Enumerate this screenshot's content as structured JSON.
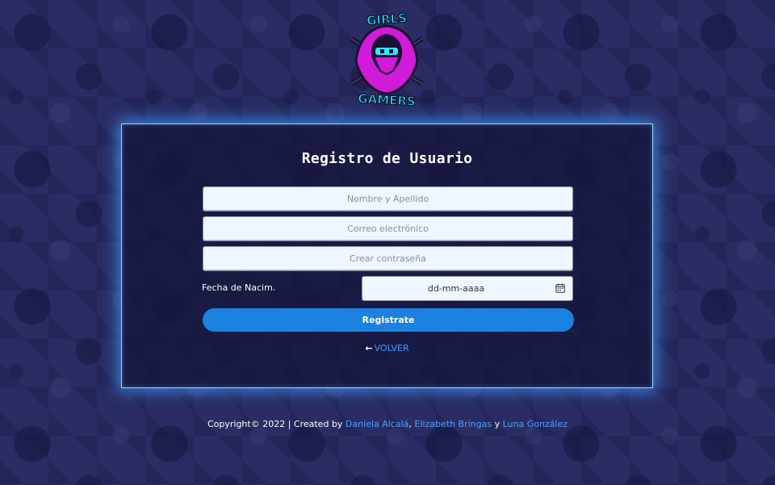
{
  "logo": {
    "top_text": "GIRLS",
    "bottom_text": "GAMERS",
    "colors": {
      "accent": "#2ee8ff",
      "hood": "#d21bd8",
      "dark": "#1a1033"
    }
  },
  "card": {
    "title": "Registro de Usuario",
    "name_placeholder": "Nombre y Apellido",
    "email_placeholder": "Correo electrónico",
    "password_placeholder": "Crear contraseña",
    "date_label": "Fecha de Nacim.",
    "date_placeholder": "dd-mm-aaaa",
    "date_icon": "calendar-icon",
    "register_label": "Registrate",
    "back_icon": "arrow-left-icon",
    "back_label": "VOLVER"
  },
  "footer": {
    "prefix": "Copyright© 2022 | Created by",
    "author1": "Daniela Alcalá",
    "sep1": ",",
    "author2": "Elizabeth Bringas",
    "sep2": "y",
    "author3": "Luna González"
  },
  "colors": {
    "background": "#2a2c63",
    "card_glow": "#3ca0ff",
    "button": "#1b82e0",
    "link": "#4aa3ff"
  }
}
